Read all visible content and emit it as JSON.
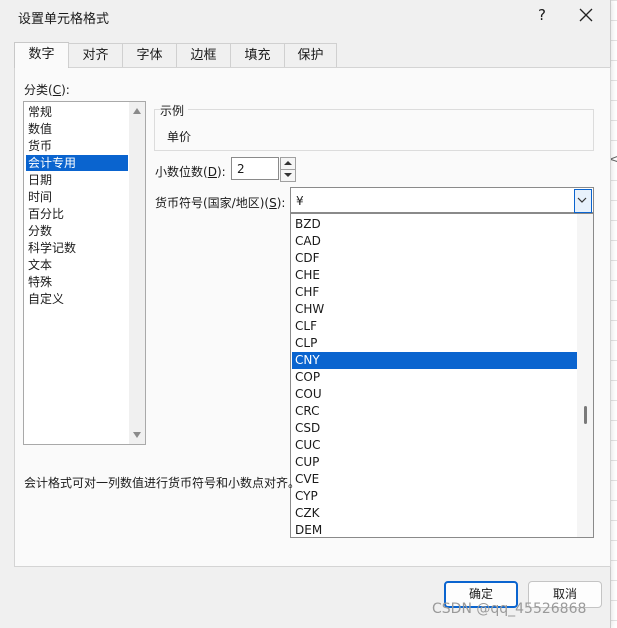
{
  "dialog": {
    "title": "设置单元格格式",
    "help_label": "?"
  },
  "tabs": [
    "数字",
    "对齐",
    "字体",
    "边框",
    "填充",
    "保护"
  ],
  "active_tab_index": 0,
  "category": {
    "label_text": "分类(",
    "label_key": "C",
    "label_end": "):",
    "items": [
      "常规",
      "数值",
      "货币",
      "会计专用",
      "日期",
      "时间",
      "百分比",
      "分数",
      "科学记数",
      "文本",
      "特殊",
      "自定义"
    ],
    "selected_index": 3
  },
  "sample": {
    "title": "示例",
    "value": "单价"
  },
  "decimals": {
    "label_text": "小数位数(",
    "label_key": "D",
    "label_end": "):",
    "value": "2"
  },
  "currency": {
    "label_text": "货币符号(国家/地区)(",
    "label_key": "S",
    "label_end": "):",
    "value": "¥",
    "options": [
      "BZD",
      "CAD",
      "CDF",
      "CHE",
      "CHF",
      "CHW",
      "CLF",
      "CLP",
      "CNY",
      "COP",
      "COU",
      "CRC",
      "CSD",
      "CUC",
      "CUP",
      "CVE",
      "CYP",
      "CZK",
      "DEM"
    ],
    "highlighted_index": 8
  },
  "description": "会计格式可对一列数值进行货币符号和小数点对齐。",
  "buttons": {
    "ok": "确定",
    "cancel": "取消"
  },
  "watermark": "CSDN @qq_45526868",
  "edge_char": "<",
  "colors": {
    "selection": "#0a64cf",
    "dialog_bg": "#f0f0f0"
  }
}
